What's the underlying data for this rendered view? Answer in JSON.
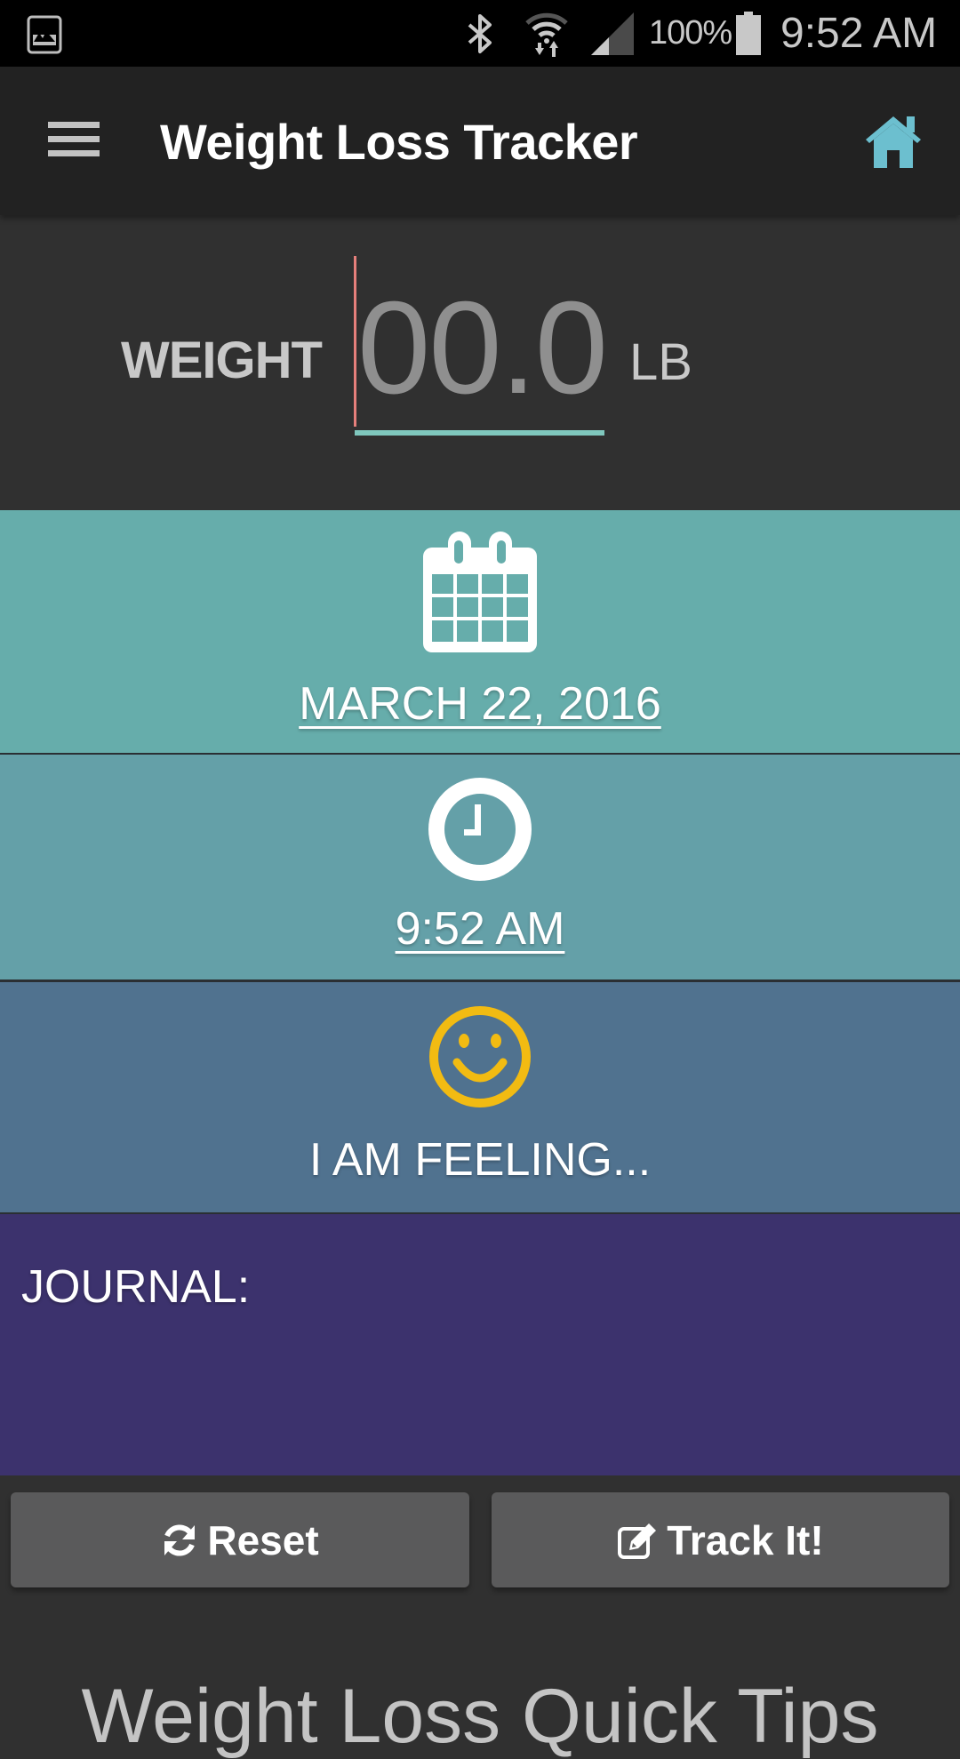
{
  "status_bar": {
    "battery_percent": "100%",
    "time": "9:52 AM",
    "icons": [
      "gallery-notification-icon",
      "bluetooth-icon",
      "wifi-icon",
      "cell-signal-icon",
      "battery-icon"
    ]
  },
  "app_bar": {
    "title": "Weight Loss Tracker",
    "menu_icon": "hamburger-menu-icon",
    "home_icon": "home-icon",
    "home_icon_color": "#6cbfcf"
  },
  "weight": {
    "label": "WEIGHT",
    "placeholder": "00.0",
    "value": "",
    "unit": "LB",
    "cursor_color": "#e57f7b",
    "underline_color": "#7fc7bd"
  },
  "date_panel": {
    "icon": "calendar-icon",
    "label": "MARCH 22, 2016",
    "background": "#66adab"
  },
  "time_panel": {
    "icon": "clock-icon",
    "label": "9:52 AM",
    "background": "#64a0a8"
  },
  "feeling_panel": {
    "icon": "smiley-face-icon",
    "label": "I AM FEELING...",
    "background": "#50728f",
    "icon_color": "#f2bb12"
  },
  "journal": {
    "label": "JOURNAL:",
    "value": "",
    "background": "#3c326d"
  },
  "buttons": {
    "reset": {
      "label": "Reset",
      "icon": "refresh-icon"
    },
    "track": {
      "label": "Track It!",
      "icon": "edit-icon"
    }
  },
  "tips": {
    "heading": "Weight Loss Quick Tips"
  }
}
